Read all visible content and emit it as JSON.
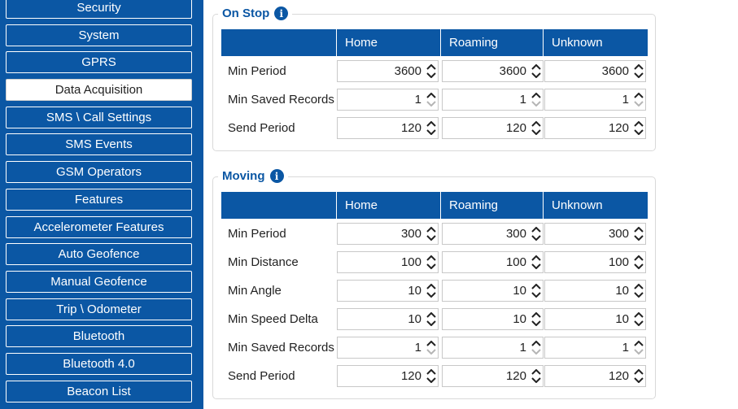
{
  "sidebar": {
    "items": [
      {
        "label": "Security",
        "active": false
      },
      {
        "label": "System",
        "active": false
      },
      {
        "label": "GPRS",
        "active": false
      },
      {
        "label": "Data Acquisition",
        "active": true
      },
      {
        "label": "SMS \\ Call Settings",
        "active": false
      },
      {
        "label": "SMS Events",
        "active": false
      },
      {
        "label": "GSM Operators",
        "active": false
      },
      {
        "label": "Features",
        "active": false
      },
      {
        "label": "Accelerometer Features",
        "active": false
      },
      {
        "label": "Auto Geofence",
        "active": false
      },
      {
        "label": "Manual Geofence",
        "active": false
      },
      {
        "label": "Trip \\ Odometer",
        "active": false
      },
      {
        "label": "Bluetooth",
        "active": false
      },
      {
        "label": "Bluetooth 4.0",
        "active": false
      },
      {
        "label": "Beacon List",
        "active": false
      }
    ]
  },
  "on_stop": {
    "title": "On Stop",
    "columns": [
      "",
      "Home",
      "Roaming",
      "Unknown"
    ],
    "rows": [
      {
        "label": "Min Period",
        "values": [
          "3600",
          "3600",
          "3600"
        ]
      },
      {
        "label": "Min Saved Records",
        "values": [
          "1",
          "1",
          "1"
        ]
      },
      {
        "label": "Send Period",
        "values": [
          "120",
          "120",
          "120"
        ]
      }
    ]
  },
  "moving": {
    "title": "Moving",
    "columns": [
      "",
      "Home",
      "Roaming",
      "Unknown"
    ],
    "rows": [
      {
        "label": "Min Period",
        "values": [
          "300",
          "300",
          "300"
        ]
      },
      {
        "label": "Min Distance",
        "values": [
          "100",
          "100",
          "100"
        ]
      },
      {
        "label": "Min Angle",
        "values": [
          "10",
          "10",
          "10"
        ]
      },
      {
        "label": "Min Speed Delta",
        "values": [
          "10",
          "10",
          "10"
        ]
      },
      {
        "label": "Min Saved Records",
        "values": [
          "1",
          "1",
          "1"
        ]
      },
      {
        "label": "Send Period",
        "values": [
          "120",
          "120",
          "120"
        ]
      }
    ]
  },
  "colors": {
    "accent": "#0b57a4",
    "background": "#ffffff"
  }
}
